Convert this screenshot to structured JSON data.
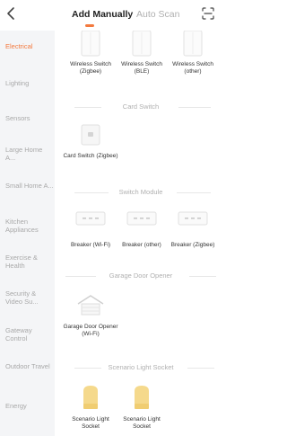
{
  "header": {
    "tab_manual": "Add Manually",
    "tab_auto": "Auto Scan",
    "accent": "#f37a3f"
  },
  "sidebar": {
    "items": [
      {
        "label": "Electrical",
        "active": true
      },
      {
        "label": "Lighting"
      },
      {
        "label": "Sensors"
      },
      {
        "label": "Large Home A..."
      },
      {
        "label": "Small Home A..."
      },
      {
        "label": "Kitchen Appliances"
      },
      {
        "label": "Exercise & Health"
      },
      {
        "label": "Security & Video Su..."
      },
      {
        "label": "Gateway Control"
      },
      {
        "label": "Outdoor Travel"
      },
      {
        "label": "Energy"
      }
    ]
  },
  "sections": {
    "wireless_switch": {
      "items": [
        {
          "label": "Wireless Switch (Zigbee)",
          "icon": "wireless-switch-icon"
        },
        {
          "label": "Wireless Switch (BLE)",
          "icon": "wireless-switch-icon"
        },
        {
          "label": "Wireless Switch (other)",
          "icon": "wireless-switch-icon"
        }
      ]
    },
    "card_switch": {
      "title": "Card Switch",
      "items": [
        {
          "label": "Card Switch (Zigbee)",
          "icon": "card-switch-icon"
        }
      ]
    },
    "switch_module": {
      "title": "Switch Module",
      "items": [
        {
          "label": "Breaker (Wi-Fi)",
          "icon": "breaker-icon"
        },
        {
          "label": "Breaker (other)",
          "icon": "breaker-icon"
        },
        {
          "label": "Breaker (Zigbee)",
          "icon": "breaker-icon"
        }
      ]
    },
    "garage_door": {
      "title": "Garage Door Opener",
      "items": [
        {
          "label": "Garage Door Opener (Wi-Fi)",
          "icon": "garage-door-icon"
        }
      ]
    },
    "scenario_socket": {
      "title": "Scenario Light Socket",
      "items": [
        {
          "label": "Scenario Light Socket",
          "icon": "light-socket-icon"
        },
        {
          "label": "Scenario Light Socket",
          "icon": "light-socket-icon"
        }
      ]
    }
  }
}
